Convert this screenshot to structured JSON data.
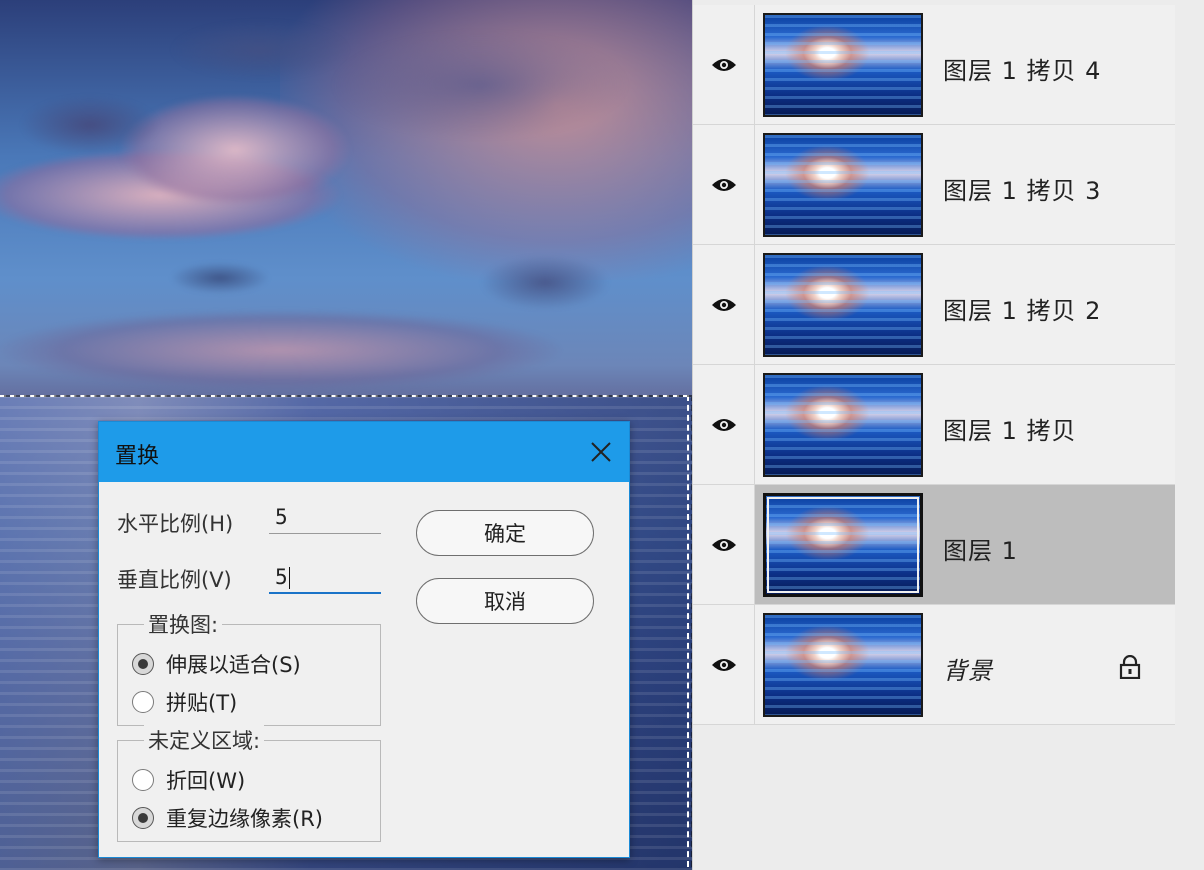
{
  "dialog": {
    "title": "置换",
    "horizontal_label": "水平比例(H)",
    "horizontal_value": "5",
    "vertical_label": "垂直比例(V)",
    "vertical_value": "5",
    "ok_label": "确定",
    "cancel_label": "取消",
    "displacement_map": {
      "title": "置换图:",
      "options": [
        {
          "label": "伸展以适合(S)",
          "selected": true
        },
        {
          "label": "拼贴(T)",
          "selected": false
        }
      ]
    },
    "undefined_areas": {
      "title": "未定义区域:",
      "options": [
        {
          "label": "折回(W)",
          "selected": false
        },
        {
          "label": "重复边缘像素(R)",
          "selected": true
        }
      ]
    }
  },
  "layers": [
    {
      "name": "图层 1 拷贝 4",
      "visible": true,
      "selected": false,
      "locked": false
    },
    {
      "name": "图层 1 拷贝 3",
      "visible": true,
      "selected": false,
      "locked": false
    },
    {
      "name": "图层 1 拷贝 2",
      "visible": true,
      "selected": false,
      "locked": false
    },
    {
      "name": "图层 1 拷贝",
      "visible": true,
      "selected": false,
      "locked": false
    },
    {
      "name": "图层 1",
      "visible": true,
      "selected": true,
      "locked": false
    },
    {
      "name": "背景",
      "visible": true,
      "selected": false,
      "locked": true
    }
  ],
  "icons": {
    "visibility": "eye-icon",
    "lock": "lock-icon",
    "close": "close-icon"
  },
  "colors": {
    "dialog_titlebar": "#1e9be9",
    "selected_layer": "#bdbdbd",
    "input_focus": "#1a73c8"
  }
}
